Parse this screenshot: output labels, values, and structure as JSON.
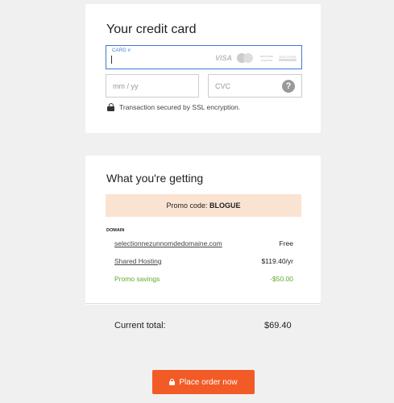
{
  "payment": {
    "title": "Your credit card",
    "card_label": "CARD #",
    "card_value": "",
    "card_brands": [
      "VISA",
      "mastercard",
      "american express",
      "DISCOVER"
    ],
    "expiry_placeholder": "mm / yy",
    "cvc_placeholder": "CVC",
    "help_icon": "?",
    "secure_text": "Transaction secured by SSL encryption."
  },
  "summary": {
    "title": "What you're getting",
    "promo_prefix": "Promo code: ",
    "promo_code": "BLOGUE",
    "section_label": "DOMAIN",
    "items": [
      {
        "name": "selectionnezunnomdedomaine.com",
        "price": "Free"
      },
      {
        "name": "Shared Hosting",
        "price": "$119.40/yr"
      },
      {
        "name": "Promo savings",
        "price": "-$50.00"
      }
    ],
    "total_label": "Current total:",
    "total_value": "$69.40"
  },
  "actions": {
    "place_order_label": "Place order now"
  },
  "colors": {
    "accent": "#f25a26",
    "focus": "#3a7bd5",
    "promo_bg": "#fbe3d2",
    "savings": "#5bab2a"
  }
}
